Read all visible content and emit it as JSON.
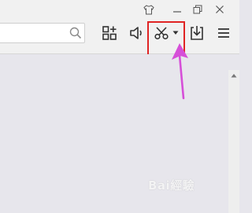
{
  "window_controls": {
    "skin_icon": "shirt-icon",
    "minimize_icon": "minimize-icon",
    "restore_icon": "restore-icon",
    "close_icon": "close-icon"
  },
  "search": {
    "value": "",
    "placeholder": "",
    "icon": "search-icon"
  },
  "toolbar": {
    "buttons": [
      {
        "id": "apps",
        "icon": "apps-grid-plus-icon"
      },
      {
        "id": "mute",
        "icon": "speaker-icon"
      },
      {
        "id": "screenshot",
        "icon": "scissors-icon",
        "has_dropdown": true
      },
      {
        "id": "download",
        "icon": "download-icon"
      },
      {
        "id": "menu",
        "icon": "hamburger-menu-icon"
      }
    ]
  },
  "annotation": {
    "highlight_color": "#e02424",
    "arrow_color": "#d64fd8"
  },
  "watermark": {
    "text": "Bai經驗",
    "icon": "paw-icon"
  },
  "colors": {
    "toolbar_bg": "#f1f1f1",
    "content_bg": "#e7e6ec",
    "icon": "#333333"
  }
}
